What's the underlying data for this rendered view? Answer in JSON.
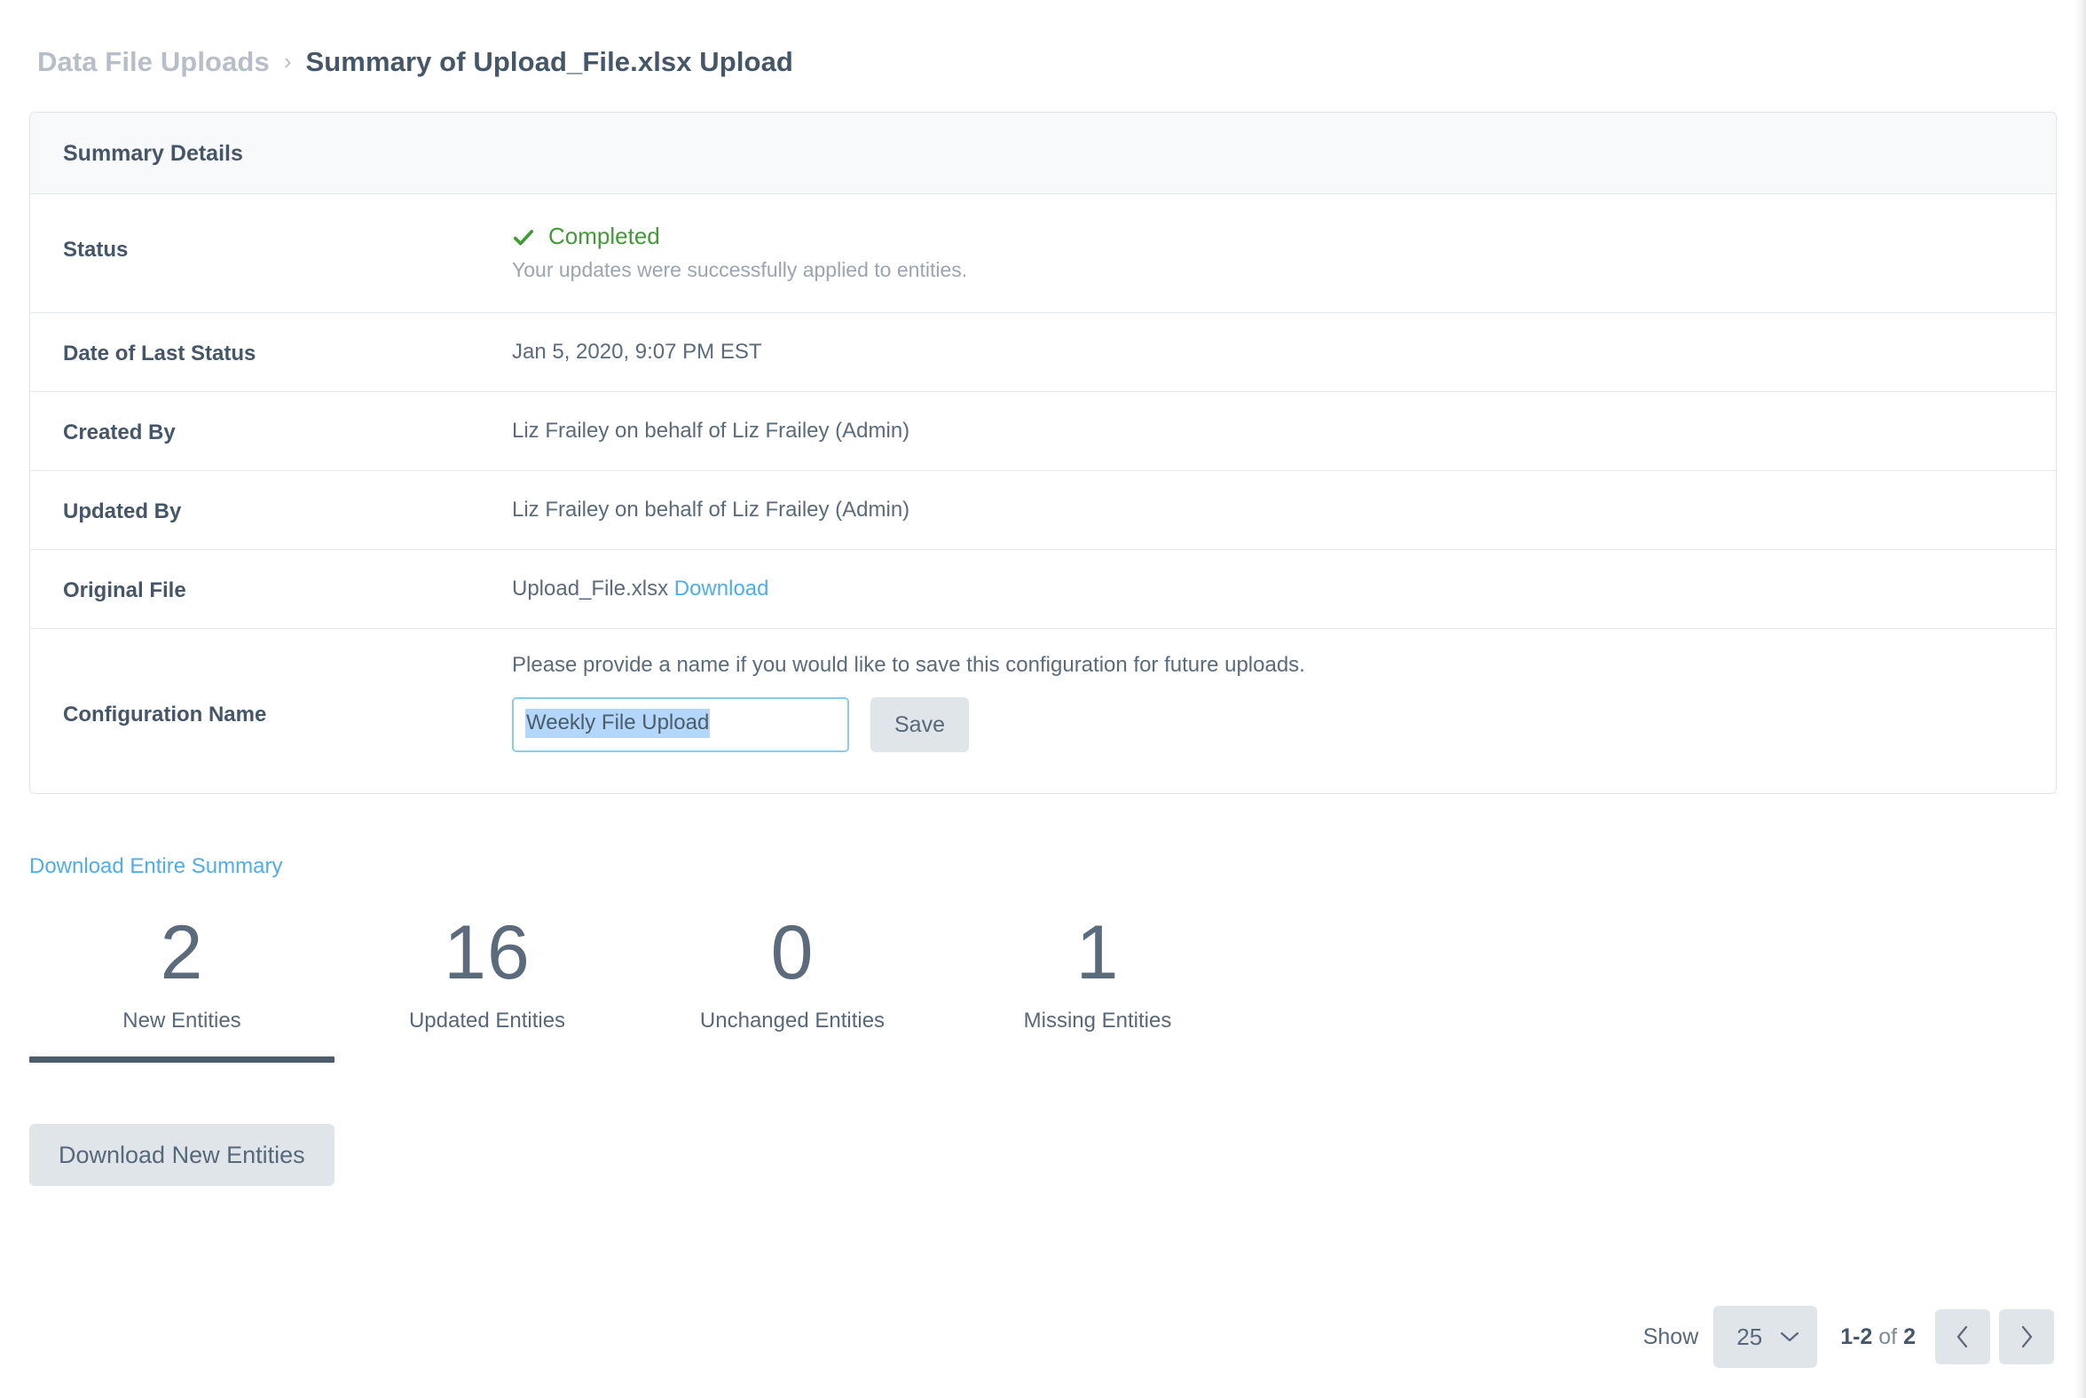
{
  "breadcrumb": {
    "parent": "Data File Uploads",
    "separator": "›",
    "current": "Summary of Upload_File.xlsx Upload"
  },
  "card": {
    "header": "Summary Details",
    "rows": {
      "status": {
        "label": "Status",
        "icon": "check-icon",
        "value": "Completed",
        "sub": "Your updates were successfully applied to entities.",
        "color": "#3f9c35"
      },
      "date_of_last_status": {
        "label": "Date of Last Status",
        "value": "Jan 5, 2020, 9:07 PM EST"
      },
      "created_by": {
        "label": "Created By",
        "value": "Liz Frailey on behalf of Liz Frailey (Admin)"
      },
      "updated_by": {
        "label": "Updated By",
        "value": "Liz Frailey on behalf of Liz Frailey (Admin)"
      },
      "original_file": {
        "label": "Original File",
        "file_name": "Upload_File.xlsx",
        "download_link": "Download"
      },
      "configuration_name": {
        "label": "Configuration Name",
        "help": "Please provide a name if you would like to save this configuration for future uploads.",
        "input_value": "Weekly File Upload",
        "input_placeholder": "",
        "save_label": "Save"
      }
    }
  },
  "download_entire_summary": "Download Entire Summary",
  "stats": [
    {
      "count": "2",
      "label": "New Entities",
      "active": true
    },
    {
      "count": "16",
      "label": "Updated Entities",
      "active": false
    },
    {
      "count": "0",
      "label": "Unchanged Entities",
      "active": false
    },
    {
      "count": "1",
      "label": "Missing Entities",
      "active": false
    }
  ],
  "download_entities_button": "Download New Entities",
  "pagination": {
    "show_label": "Show",
    "page_size": "25",
    "range": "1-2",
    "of_word": "of",
    "total": "2",
    "prev_icon": "chevron-left-icon",
    "next_icon": "chevron-right-icon"
  },
  "colors": {
    "accent_link": "#4dadef",
    "success": "#3f9c35",
    "text": "#4c5c68",
    "muted": "#9aa5b1",
    "button_bg": "#e0e5e9",
    "selection": "#b3d7fb",
    "focus_border": "#87cdf1"
  }
}
